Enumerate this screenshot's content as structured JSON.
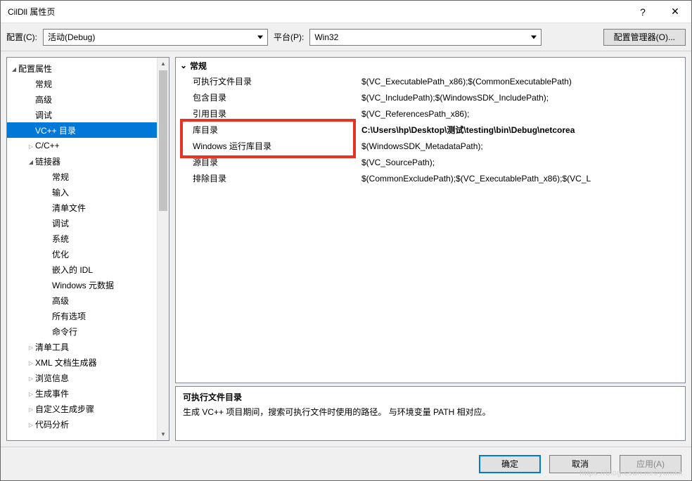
{
  "titlebar": {
    "title": "CilDll 属性页"
  },
  "toprow": {
    "config_label": "配置(C):",
    "config_value": "活动(Debug)",
    "platform_label": "平台(P):",
    "platform_value": "Win32",
    "manager_btn": "配置管理器(O)..."
  },
  "tree": {
    "root": "配置属性",
    "items": [
      {
        "label": "常规",
        "level": 1,
        "arrow": "none"
      },
      {
        "label": "高级",
        "level": 1,
        "arrow": "none"
      },
      {
        "label": "调试",
        "level": 1,
        "arrow": "none"
      },
      {
        "label": "VC++ 目录",
        "level": 1,
        "arrow": "none",
        "selected": true
      },
      {
        "label": "C/C++",
        "level": 1,
        "arrow": "closed"
      },
      {
        "label": "链接器",
        "level": 1,
        "arrow": "open"
      },
      {
        "label": "常规",
        "level": 2,
        "arrow": "none"
      },
      {
        "label": "输入",
        "level": 2,
        "arrow": "none"
      },
      {
        "label": "清单文件",
        "level": 2,
        "arrow": "none"
      },
      {
        "label": "调试",
        "level": 2,
        "arrow": "none"
      },
      {
        "label": "系统",
        "level": 2,
        "arrow": "none"
      },
      {
        "label": "优化",
        "level": 2,
        "arrow": "none"
      },
      {
        "label": "嵌入的 IDL",
        "level": 2,
        "arrow": "none"
      },
      {
        "label": "Windows 元数据",
        "level": 2,
        "arrow": "none"
      },
      {
        "label": "高级",
        "level": 2,
        "arrow": "none"
      },
      {
        "label": "所有选项",
        "level": 2,
        "arrow": "none"
      },
      {
        "label": "命令行",
        "level": 2,
        "arrow": "none"
      },
      {
        "label": "清单工具",
        "level": 1,
        "arrow": "closed"
      },
      {
        "label": "XML 文档生成器",
        "level": 1,
        "arrow": "closed"
      },
      {
        "label": "浏览信息",
        "level": 1,
        "arrow": "closed"
      },
      {
        "label": "生成事件",
        "level": 1,
        "arrow": "closed"
      },
      {
        "label": "自定义生成步骤",
        "level": 1,
        "arrow": "closed"
      },
      {
        "label": "代码分析",
        "level": 1,
        "arrow": "closed"
      }
    ]
  },
  "props": {
    "group": "常规",
    "rows": [
      {
        "key": "可执行文件目录",
        "val": "$(VC_ExecutablePath_x86);$(CommonExecutablePath)"
      },
      {
        "key": "包含目录",
        "val": "$(VC_IncludePath);$(WindowsSDK_IncludePath);"
      },
      {
        "key": "引用目录",
        "val": "$(VC_ReferencesPath_x86);"
      },
      {
        "key": "库目录",
        "val": "C:\\Users\\hp\\Desktop\\测试\\testing\\bin\\Debug\\netcorea",
        "bold": true
      },
      {
        "key": "Windows 运行库目录",
        "val": "$(WindowsSDK_MetadataPath);"
      },
      {
        "key": "源目录",
        "val": "$(VC_SourcePath);"
      },
      {
        "key": "排除目录",
        "val": "$(CommonExcludePath);$(VC_ExecutablePath_x86);$(VC_L"
      }
    ]
  },
  "desc": {
    "title": "可执行文件目录",
    "body": "生成 VC++ 项目期间，搜索可执行文件时使用的路径。  与环境变量 PATH 相对应。"
  },
  "footer": {
    "ok": "确定",
    "cancel": "取消",
    "apply": "应用(A)"
  },
  "watermark": "https://blog.csdn.net/yumkk"
}
